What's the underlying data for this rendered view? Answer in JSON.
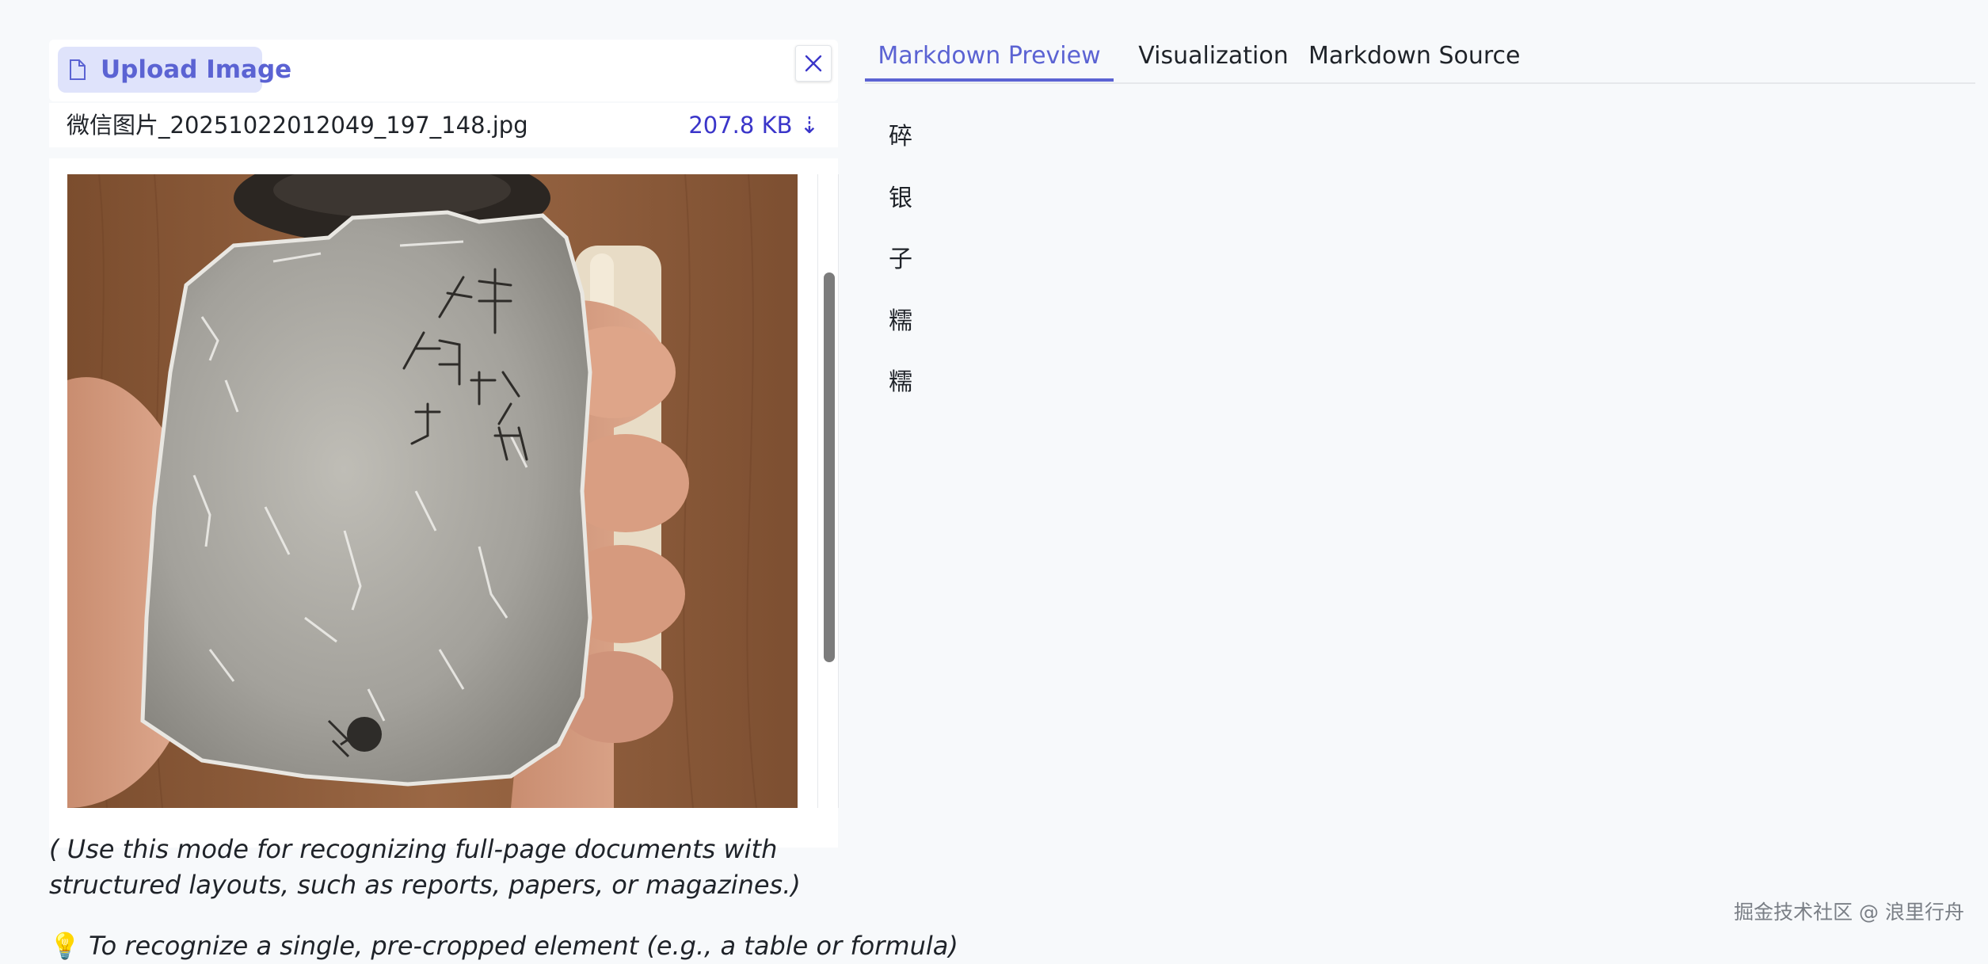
{
  "upload": {
    "button_label": "Upload Image",
    "file_name": "微信图片_20251022012049_197_148.jpg",
    "file_size": "207.8 KB ⇣"
  },
  "photo": {
    "card_text": [
      "碎",
      "银",
      "子",
      "糯",
      "糯"
    ]
  },
  "notes": {
    "mode_hint": "( Use this mode for recognizing full-page documents with structured layouts, such as reports, papers, or magazines.)",
    "tip_icon": "💡",
    "tip_text": "To recognize a single, pre-cropped element (e.g., a table or formula)"
  },
  "tabs": [
    {
      "label": "Markdown Preview",
      "active": true
    },
    {
      "label": "Visualization",
      "active": false
    },
    {
      "label": "Markdown Source",
      "active": false
    }
  ],
  "preview": {
    "lines": [
      "碎",
      "银",
      "子",
      "糯",
      "糯"
    ]
  },
  "watermark": "掘金技术社区 @ 浪里行舟",
  "colors": {
    "accent": "#5b63d3",
    "file_size": "#3a35c9",
    "upload_bg": "#dfe3fb"
  }
}
